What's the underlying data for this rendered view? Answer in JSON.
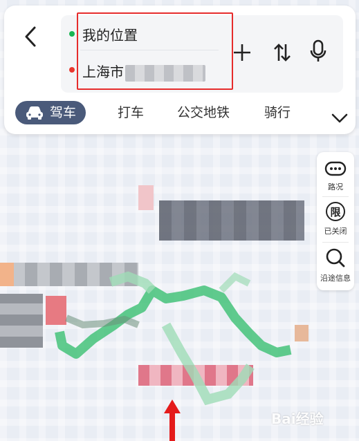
{
  "route_panel": {
    "origin": "我的位置",
    "destination": "上海市",
    "origin_dot_color": "#1ab552",
    "destination_dot_color": "#e8382f",
    "highlight_color": "#e62b2b"
  },
  "actions": {
    "add_icon": "plus-icon",
    "swap_icon": "swap-icon",
    "voice_icon": "microphone-icon"
  },
  "modes": [
    {
      "label": "驾车",
      "active": true
    },
    {
      "label": "打车",
      "active": false
    },
    {
      "label": "公交地铁",
      "active": false
    },
    {
      "label": "骑行",
      "active": false
    }
  ],
  "map_tools": [
    {
      "label": "路况",
      "icon": "traffic-icon"
    },
    {
      "label": "已关闭",
      "icon": "restriction-icon",
      "glyph": "限"
    },
    {
      "label": "沿途信息",
      "icon": "search-icon"
    }
  ],
  "watermark": "Bai经验",
  "colors": {
    "accent": "#4a5a7a",
    "route_green": "#2ebc6a",
    "arrow": "#e41b1b"
  }
}
